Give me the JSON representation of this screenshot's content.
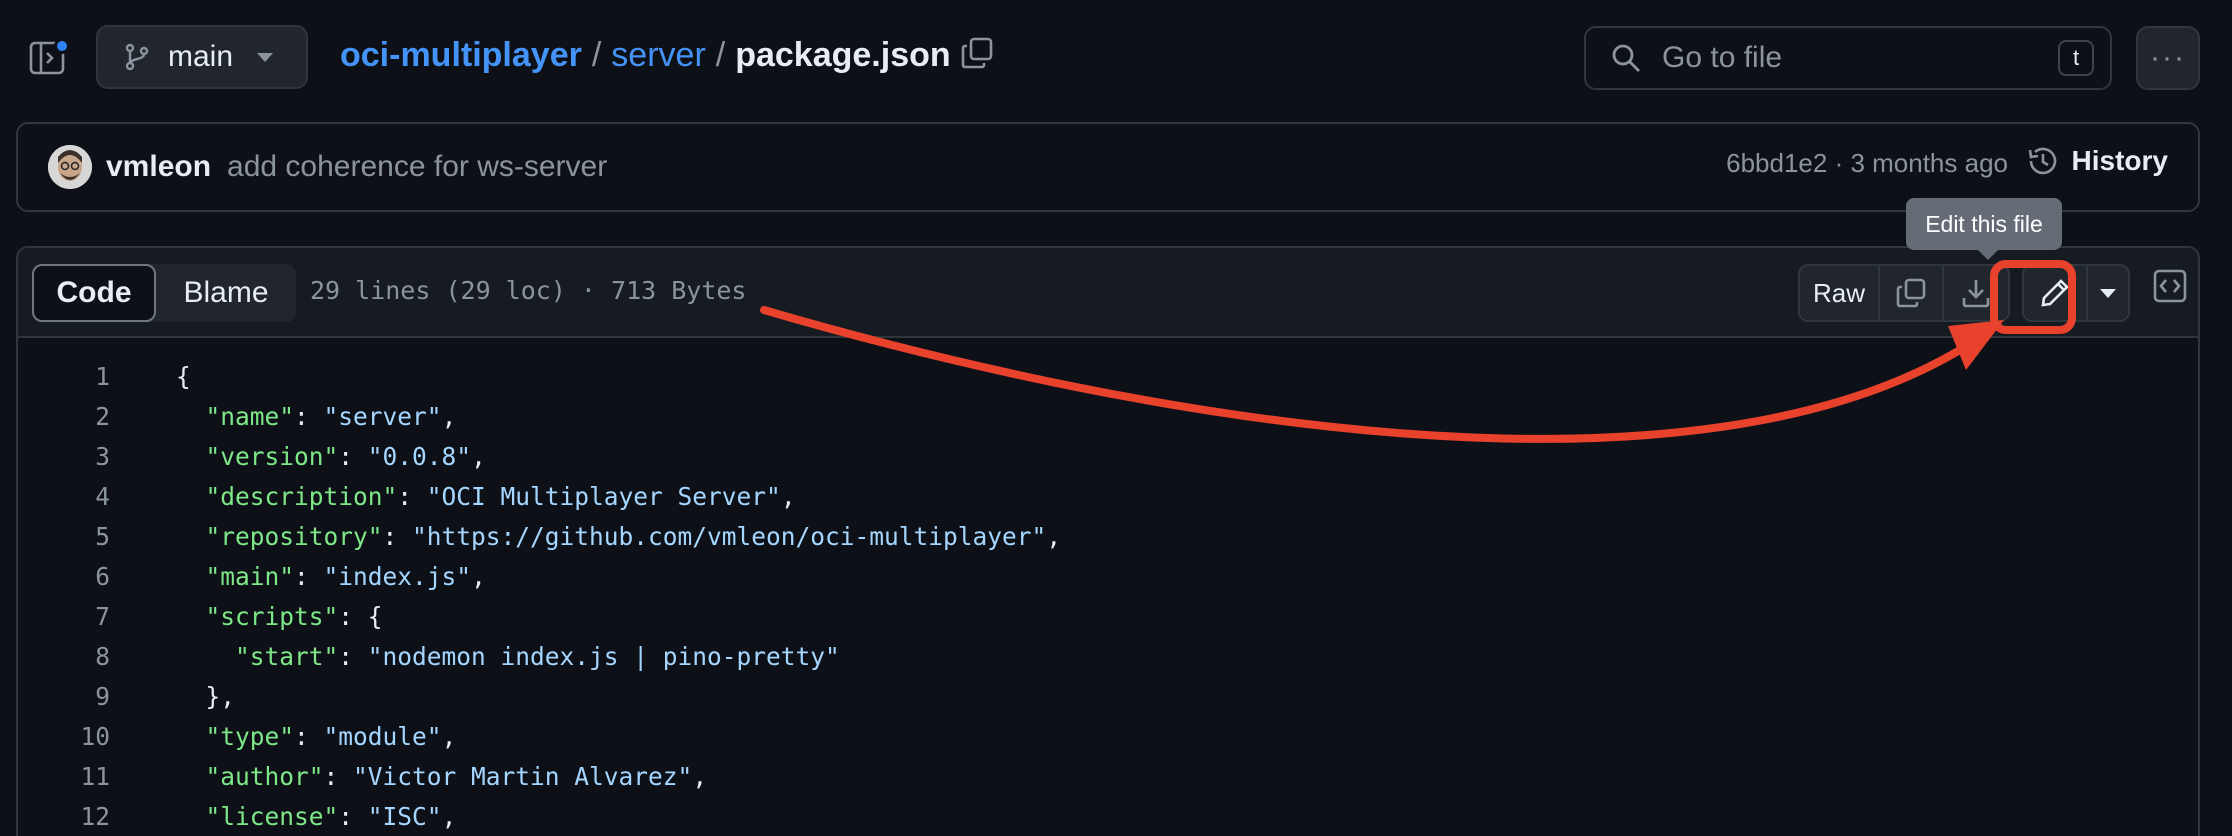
{
  "topbar": {
    "branch": "main",
    "breadcrumb": {
      "repo": "oci-multiplayer",
      "sep1": "/",
      "dir": "server",
      "sep2": "/",
      "file": "package.json"
    },
    "search_placeholder": "Go to file",
    "search_shortcut": "t",
    "more_label": "···"
  },
  "commit": {
    "author": "vmleon",
    "message": "add coherence for ws-server",
    "meta": "6bbd1e2 · 3 months ago",
    "history_label": "History"
  },
  "tooltip": "Edit this file",
  "file": {
    "tabs": {
      "code": "Code",
      "blame": "Blame"
    },
    "info": "29 lines (29 loc) · 713 Bytes",
    "raw_label": "Raw",
    "lines": [
      {
        "n": "1",
        "pre": "{",
        "key": "",
        "mid": "",
        "val": "",
        "post": ""
      },
      {
        "n": "2",
        "pre": "  ",
        "key": "\"name\"",
        "mid": ": ",
        "val": "\"server\"",
        "post": ","
      },
      {
        "n": "3",
        "pre": "  ",
        "key": "\"version\"",
        "mid": ": ",
        "val": "\"0.0.8\"",
        "post": ","
      },
      {
        "n": "4",
        "pre": "  ",
        "key": "\"description\"",
        "mid": ": ",
        "val": "\"OCI Multiplayer Server\"",
        "post": ","
      },
      {
        "n": "5",
        "pre": "  ",
        "key": "\"repository\"",
        "mid": ": ",
        "val": "\"https://github.com/vmleon/oci-multiplayer\"",
        "post": ","
      },
      {
        "n": "6",
        "pre": "  ",
        "key": "\"main\"",
        "mid": ": ",
        "val": "\"index.js\"",
        "post": ","
      },
      {
        "n": "7",
        "pre": "  ",
        "key": "\"scripts\"",
        "mid": ": {",
        "val": "",
        "post": ""
      },
      {
        "n": "8",
        "pre": "    ",
        "key": "\"start\"",
        "mid": ": ",
        "val": "\"nodemon index.js | pino-pretty\"",
        "post": ""
      },
      {
        "n": "9",
        "pre": "  },",
        "key": "",
        "mid": "",
        "val": "",
        "post": ""
      },
      {
        "n": "10",
        "pre": "  ",
        "key": "\"type\"",
        "mid": ": ",
        "val": "\"module\"",
        "post": ","
      },
      {
        "n": "11",
        "pre": "  ",
        "key": "\"author\"",
        "mid": ": ",
        "val": "\"Victor Martin Alvarez\"",
        "post": ","
      },
      {
        "n": "12",
        "pre": "  ",
        "key": "\"license\"",
        "mid": ": ",
        "val": "\"ISC\"",
        "post": ","
      }
    ]
  },
  "colors": {
    "accent_link": "#4493f8",
    "json_key": "#7ee787",
    "json_string": "#a5d6ff",
    "annotation": "#e8412c"
  },
  "icons": [
    "sidebar-toggle-icon",
    "git-branch-icon",
    "copy-icon",
    "search-icon",
    "kebab-icon",
    "history-icon",
    "download-icon",
    "pencil-icon",
    "triangle-down-icon",
    "code-square-icon"
  ]
}
